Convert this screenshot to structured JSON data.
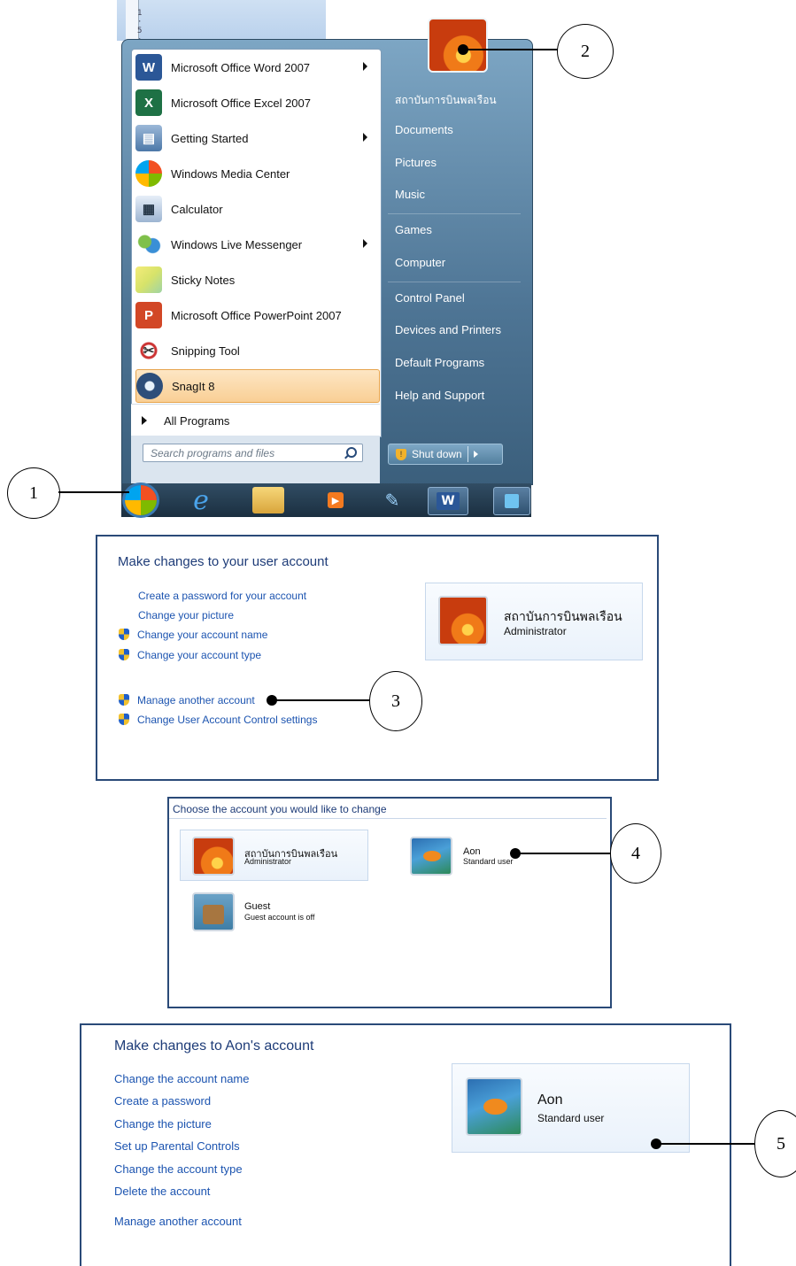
{
  "start_menu": {
    "ruler_marks": [
      "1",
      "·",
      "5",
      "·",
      "1"
    ],
    "programs": [
      {
        "label": "Microsoft Office Word 2007",
        "icon": "word-icon",
        "submenu": true
      },
      {
        "label": "Microsoft Office Excel 2007",
        "icon": "excel-icon",
        "submenu": false
      },
      {
        "label": "Getting Started",
        "icon": "getting-started-icon",
        "submenu": true
      },
      {
        "label": "Windows Media Center",
        "icon": "media-center-icon",
        "submenu": false
      },
      {
        "label": "Calculator",
        "icon": "calculator-icon",
        "submenu": false
      },
      {
        "label": "Windows Live Messenger",
        "icon": "messenger-icon",
        "submenu": true
      },
      {
        "label": "Sticky Notes",
        "icon": "sticky-notes-icon",
        "submenu": false
      },
      {
        "label": "Microsoft Office PowerPoint 2007",
        "icon": "powerpoint-icon",
        "submenu": false
      },
      {
        "label": "Snipping Tool",
        "icon": "snipping-tool-icon",
        "submenu": false
      },
      {
        "label": "SnagIt 8",
        "icon": "snagit-icon",
        "submenu": false,
        "highlighted": true
      }
    ],
    "all_programs": "All Programs",
    "search_placeholder": "Search programs and files",
    "right_items": [
      "สถาบันการบินพลเรือน",
      "Documents",
      "Pictures",
      "Music",
      "Games",
      "Computer",
      "Control Panel",
      "Devices and Printers",
      "Default Programs",
      "Help and Support"
    ],
    "shutdown_label": "Shut down",
    "taskbar_icons": [
      "start-orb-icon",
      "internet-explorer-icon",
      "windows-explorer-icon",
      "media-player-icon",
      "paint-icon",
      "word-icon",
      "control-icon"
    ]
  },
  "callouts": [
    "1",
    "2",
    "3",
    "4",
    "5"
  ],
  "panel1": {
    "title": "Make changes to your user account",
    "links": [
      {
        "label": "Create a password for your account",
        "shield": false
      },
      {
        "label": "Change your picture",
        "shield": false
      },
      {
        "label": "Change your account name",
        "shield": true
      },
      {
        "label": "Change your account type",
        "shield": true
      },
      {
        "label": "Manage another account",
        "shield": true
      },
      {
        "label": "Change User Account Control settings",
        "shield": true
      }
    ],
    "account": {
      "name": "สถาบันการบินพลเรือน",
      "type": "Administrator"
    }
  },
  "panel2": {
    "title": "Choose the account you would like to change",
    "accounts": [
      {
        "name": "สถาบันการบินพลเรือน",
        "type": "Administrator"
      },
      {
        "name": "Aon",
        "type": "Standard user"
      },
      {
        "name": "Guest",
        "type": "Guest account is off"
      }
    ]
  },
  "panel3": {
    "title": "Make changes to Aon's account",
    "links": [
      "Change the account name",
      "Create a password",
      "Change the picture",
      "Set up Parental Controls",
      "Change the account type",
      "Delete the account",
      "Manage another account"
    ],
    "account": {
      "name": "Aon",
      "type": "Standard user"
    }
  },
  "colors": {
    "link": "#1c54b0",
    "title": "#1e3c78",
    "panel_border": "#2a4a78",
    "start_menu": "#4e7595"
  }
}
